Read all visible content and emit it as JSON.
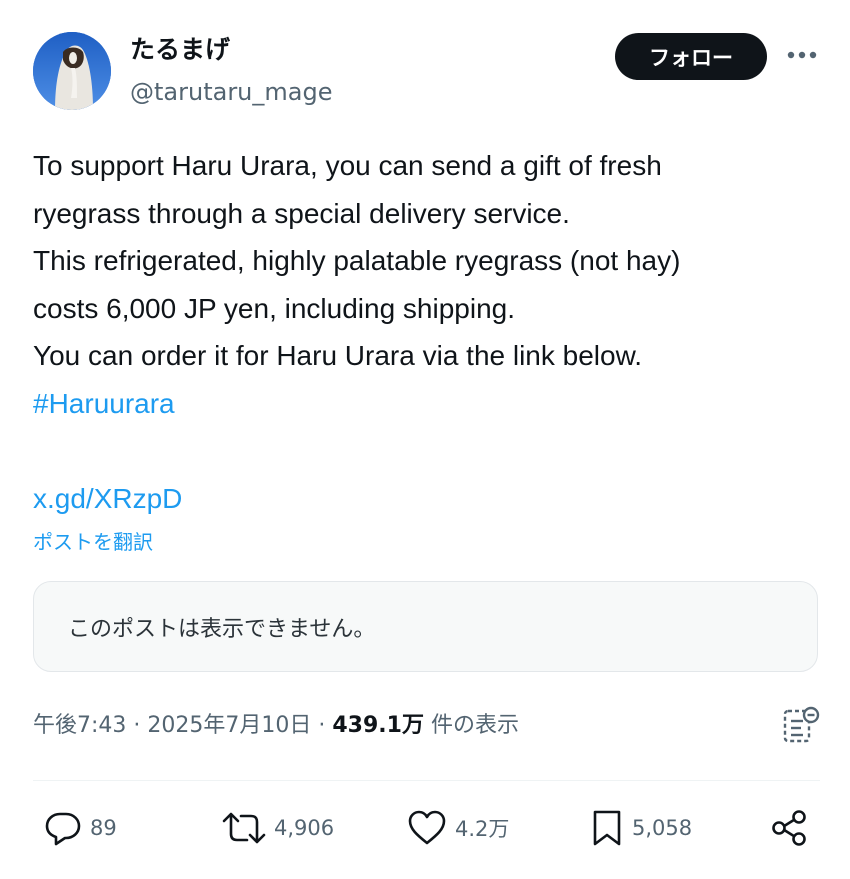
{
  "author": {
    "display_name": "たるまげ",
    "handle": "@tarutaru_mage",
    "avatar_icon": "avatar-photo"
  },
  "header": {
    "follow_label": "フォロー",
    "more_icon": "more-horizontal-icon"
  },
  "post": {
    "lines": [
      "To support Haru Urara, you can send a gift of fresh",
      "ryegrass through a special delivery service.",
      "This refrigerated, highly palatable ryegrass (not hay)",
      "costs 6,000 JP yen, including shipping.",
      "You can order it for Haru Urara via the link below."
    ],
    "hashtag": "#Haruurara",
    "link": "x.gd/XRzpD",
    "translate_label": "ポストを翻訳"
  },
  "quote": {
    "unavailable_text": "このポストは表示できません。"
  },
  "meta": {
    "time": "午後7:43",
    "separator": " · ",
    "date": "2025年7月10日",
    "views_count": "439.1万",
    "views_label": " 件の表示"
  },
  "actions": {
    "replies": "89",
    "reposts": "4,906",
    "likes": "4.2万",
    "bookmarks": "5,058"
  },
  "colors": {
    "link": "#1d9bf0",
    "text": "#0f1419",
    "secondary": "#536471",
    "follow_bg": "#0f1419"
  }
}
